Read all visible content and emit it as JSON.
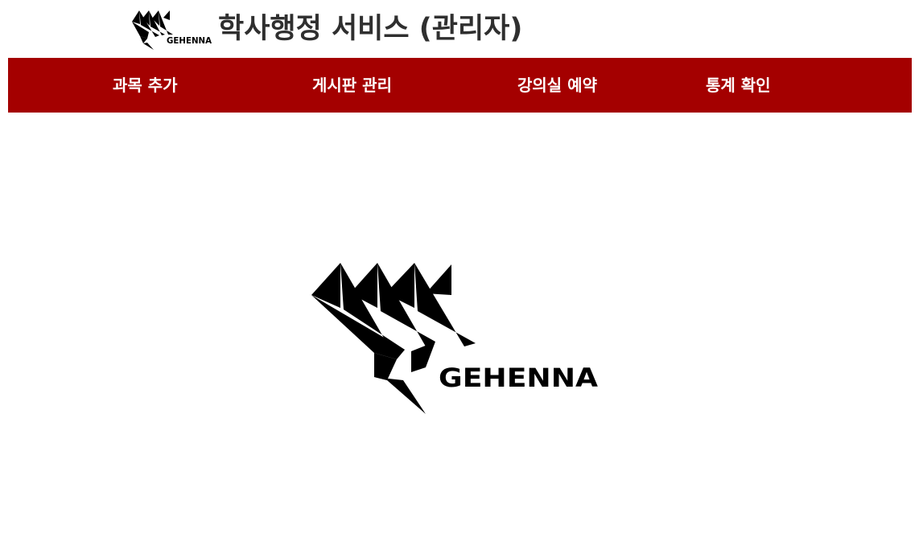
{
  "header": {
    "title": "학사행정 서비스 (관리자)",
    "logo_icon": "gehenna-logo-icon",
    "logo_text": "GEHENNA"
  },
  "nav": {
    "background": "#a40000",
    "items": [
      {
        "label": "과목 추가"
      },
      {
        "label": "게시판 관리"
      },
      {
        "label": "강의실 예약"
      },
      {
        "label": "통계 확인"
      }
    ]
  },
  "main": {
    "logo_icon": "gehenna-logo-icon",
    "logo_text": "GEHENNA"
  }
}
